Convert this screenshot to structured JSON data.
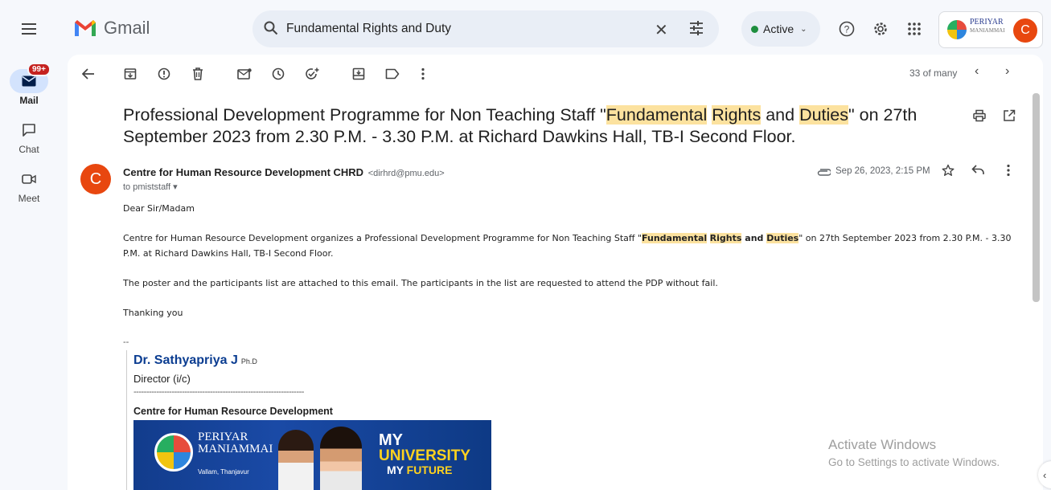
{
  "app": {
    "name": "Gmail"
  },
  "search": {
    "query": "Fundamental Rights and Duty"
  },
  "status": {
    "label": "Active"
  },
  "account": {
    "org_line1": "PERIYAR",
    "org_line2": "MANIAMMAI",
    "avatar_letter": "C"
  },
  "rail": {
    "mail_label": "Mail",
    "mail_badge": "99+",
    "chat_label": "Chat",
    "meet_label": "Meet"
  },
  "toolbar": {
    "count_label": "33 of many"
  },
  "email": {
    "subject_pre": "Professional Development Programme for Non Teaching Staff \"",
    "subject_hl1": "Fundamental",
    "subject_sp1": " ",
    "subject_hl2": "Rights",
    "subject_mid": " and ",
    "subject_hl3": "Duties",
    "subject_post": "\" on 27th September 2023 from 2.30 P.M. - 3.30 P.M. at Richard Dawkins Hall, TB-I Second Floor.",
    "sender_initial": "C",
    "sender_name": "Centre for Human Resource Development CHRD",
    "sender_email": "<dirhrd@pmu.edu>",
    "to": "to pmiststaff",
    "date": "Sep 26, 2023, 2:15 PM",
    "greeting": "Dear Sir/Madam",
    "p1_pre": "Centre for Human Resource Development organizes a Professional Development Programme for Non Teaching Staff \"",
    "p1_hl1": "Fundamental",
    "p1_hl2": "Rights",
    "p1_and": " and ",
    "p1_hl3": "Duties",
    "p1_post": "\" on 27th September 2023 from 2.30 P.M. - 3.30 P.M. at Richard Dawkins Hall, TB-I Second Floor.",
    "p2": "The poster and the participants list are attached to this email. The participants in the list are requested to attend the PDP without fail.",
    "p3": "Thanking you",
    "sig_dash": "--",
    "sig_name": "Dr. Sathyapriya J",
    "sig_degree": "Ph.D",
    "sig_role": "Director (i/c)",
    "sig_line": "-------------------------------------------------------------------",
    "sig_org": "Centre for Human Resource Development"
  },
  "banner": {
    "uni1": "PERIYAR",
    "uni2": "MANIAMMAI",
    "location": "Vallam, Thanjavur",
    "my": "MY",
    "university": "UNIVERSITY",
    "future_my": "MY",
    "future": "FUTURE"
  },
  "watermark": {
    "line1": "Activate Windows",
    "line2": "Go to Settings to activate Windows."
  }
}
